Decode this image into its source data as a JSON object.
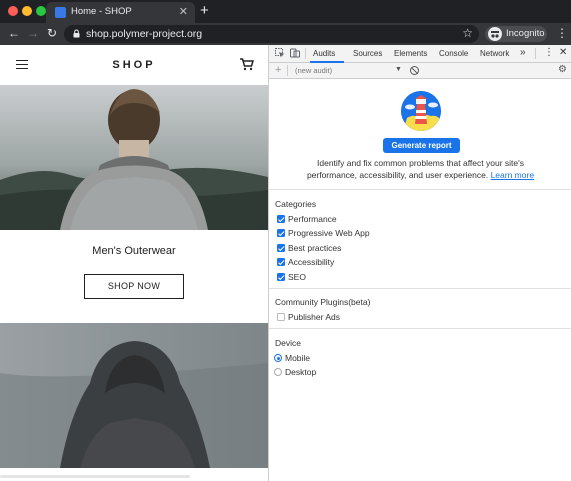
{
  "browser": {
    "tab_title": "Home - SHOP",
    "tab_close": "✕",
    "new_tab": "+",
    "url": "shop.polymer-project.org",
    "incognito_label": "Incognito",
    "colors": {
      "close": "#ff5f57",
      "minimize": "#febc2e",
      "maximize": "#28c840"
    }
  },
  "page": {
    "title": "SHOP",
    "category_title": "Men's Outerwear",
    "shop_now_label": "SHOP NOW"
  },
  "devtools": {
    "tabs": [
      "Audits",
      "Sources",
      "Elements",
      "Console",
      "Network"
    ],
    "more_tabs": "»",
    "active_tab": "Audits",
    "audit_select_value": "(new audit)",
    "generate_button_label": "Generate report",
    "description": "Identify and fix common problems that affect your site's",
    "description_line2": "performance, accessibility, and user experience.",
    "learn_more": "Learn more",
    "categories_title": "Categories",
    "categories": [
      {
        "label": "Performance",
        "checked": true
      },
      {
        "label": "Progressive Web App",
        "checked": true
      },
      {
        "label": "Best practices",
        "checked": true
      },
      {
        "label": "Accessibility",
        "checked": true
      },
      {
        "label": "SEO",
        "checked": true
      }
    ],
    "plugins_title": "Community Plugins(beta)",
    "plugins": [
      {
        "label": "Publisher Ads",
        "checked": false
      }
    ],
    "device_title": "Device",
    "devices": [
      {
        "label": "Mobile",
        "selected": true
      },
      {
        "label": "Desktop",
        "selected": false
      }
    ],
    "accent_color": "#1a73e8"
  }
}
